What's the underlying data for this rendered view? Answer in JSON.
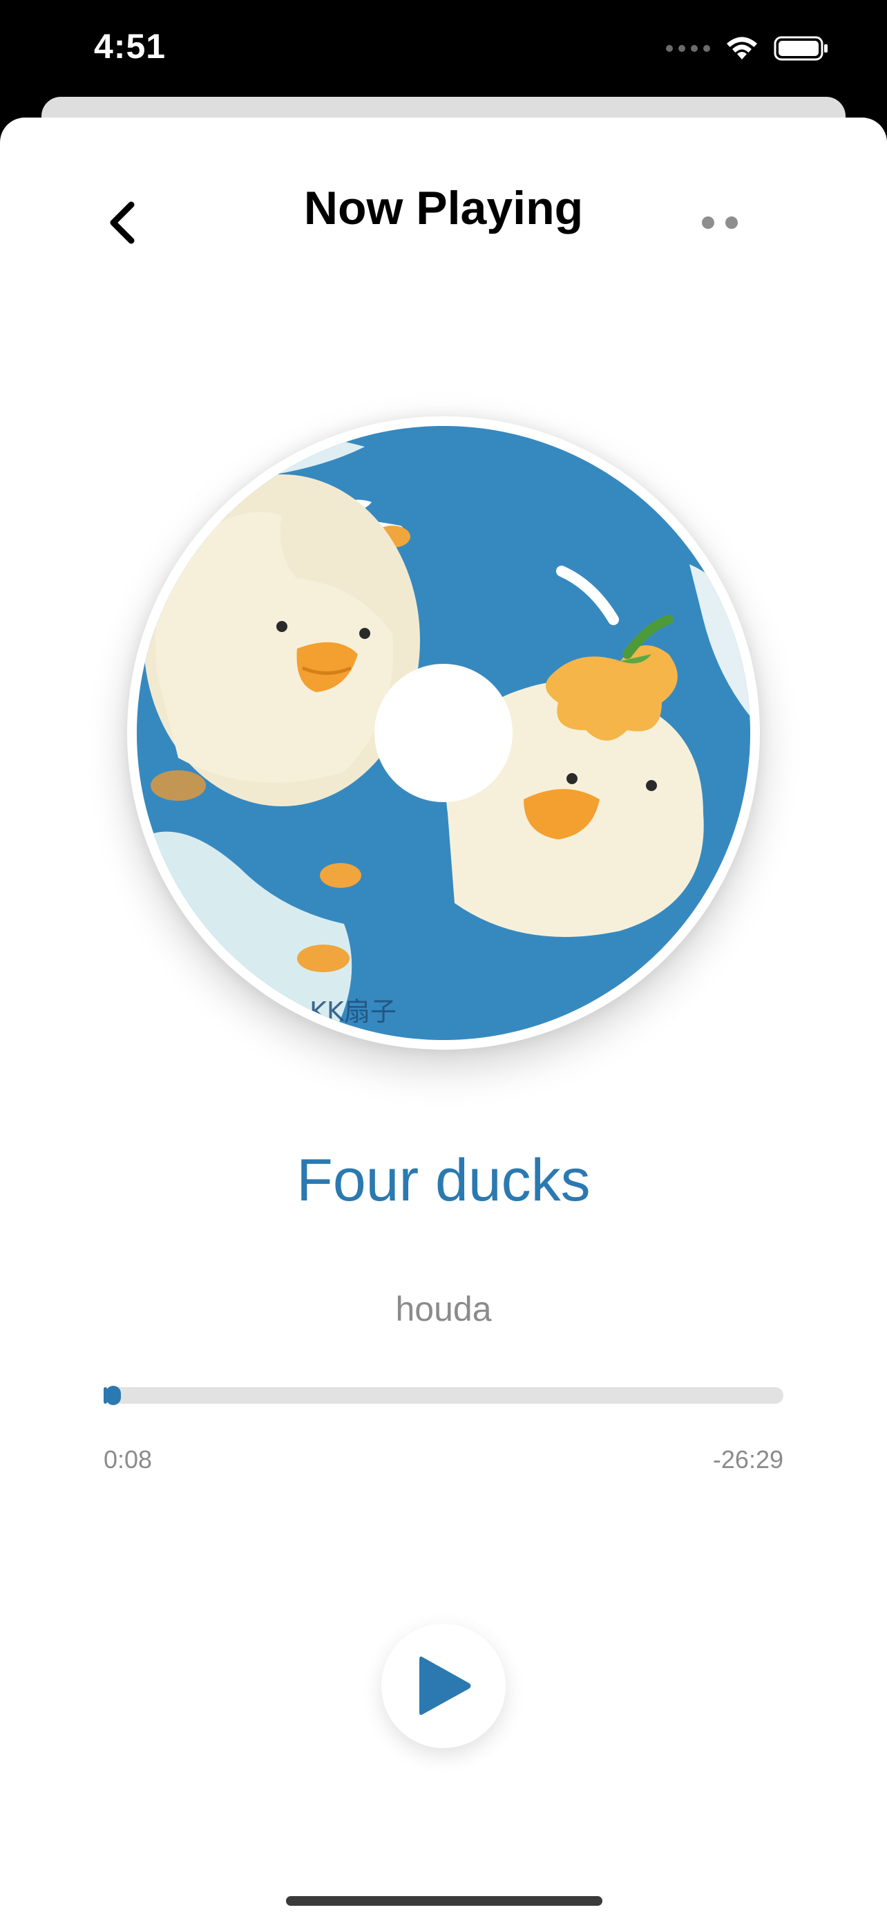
{
  "status_bar": {
    "time": "4:51",
    "icons": [
      "signal-dots-icon",
      "wifi-icon",
      "battery-icon"
    ]
  },
  "nav": {
    "back_icon": "chevron-left-icon",
    "title": "Now Playing",
    "more_icon": "more-dots-icon"
  },
  "album": {
    "art_icon": "album-art-ducks",
    "art_text": "KK扇子"
  },
  "track": {
    "title": "Four ducks",
    "artist": "houda"
  },
  "progress": {
    "elapsed": "0:08",
    "remaining": "-26:29",
    "fraction": 0.005
  },
  "controls": {
    "play_icon": "play-icon"
  },
  "colors": {
    "accent": "#2b79b0",
    "secondary_text": "#8b8b8b",
    "track_bg": "#e2e2e2",
    "disc_water": "#3b8fc4"
  }
}
